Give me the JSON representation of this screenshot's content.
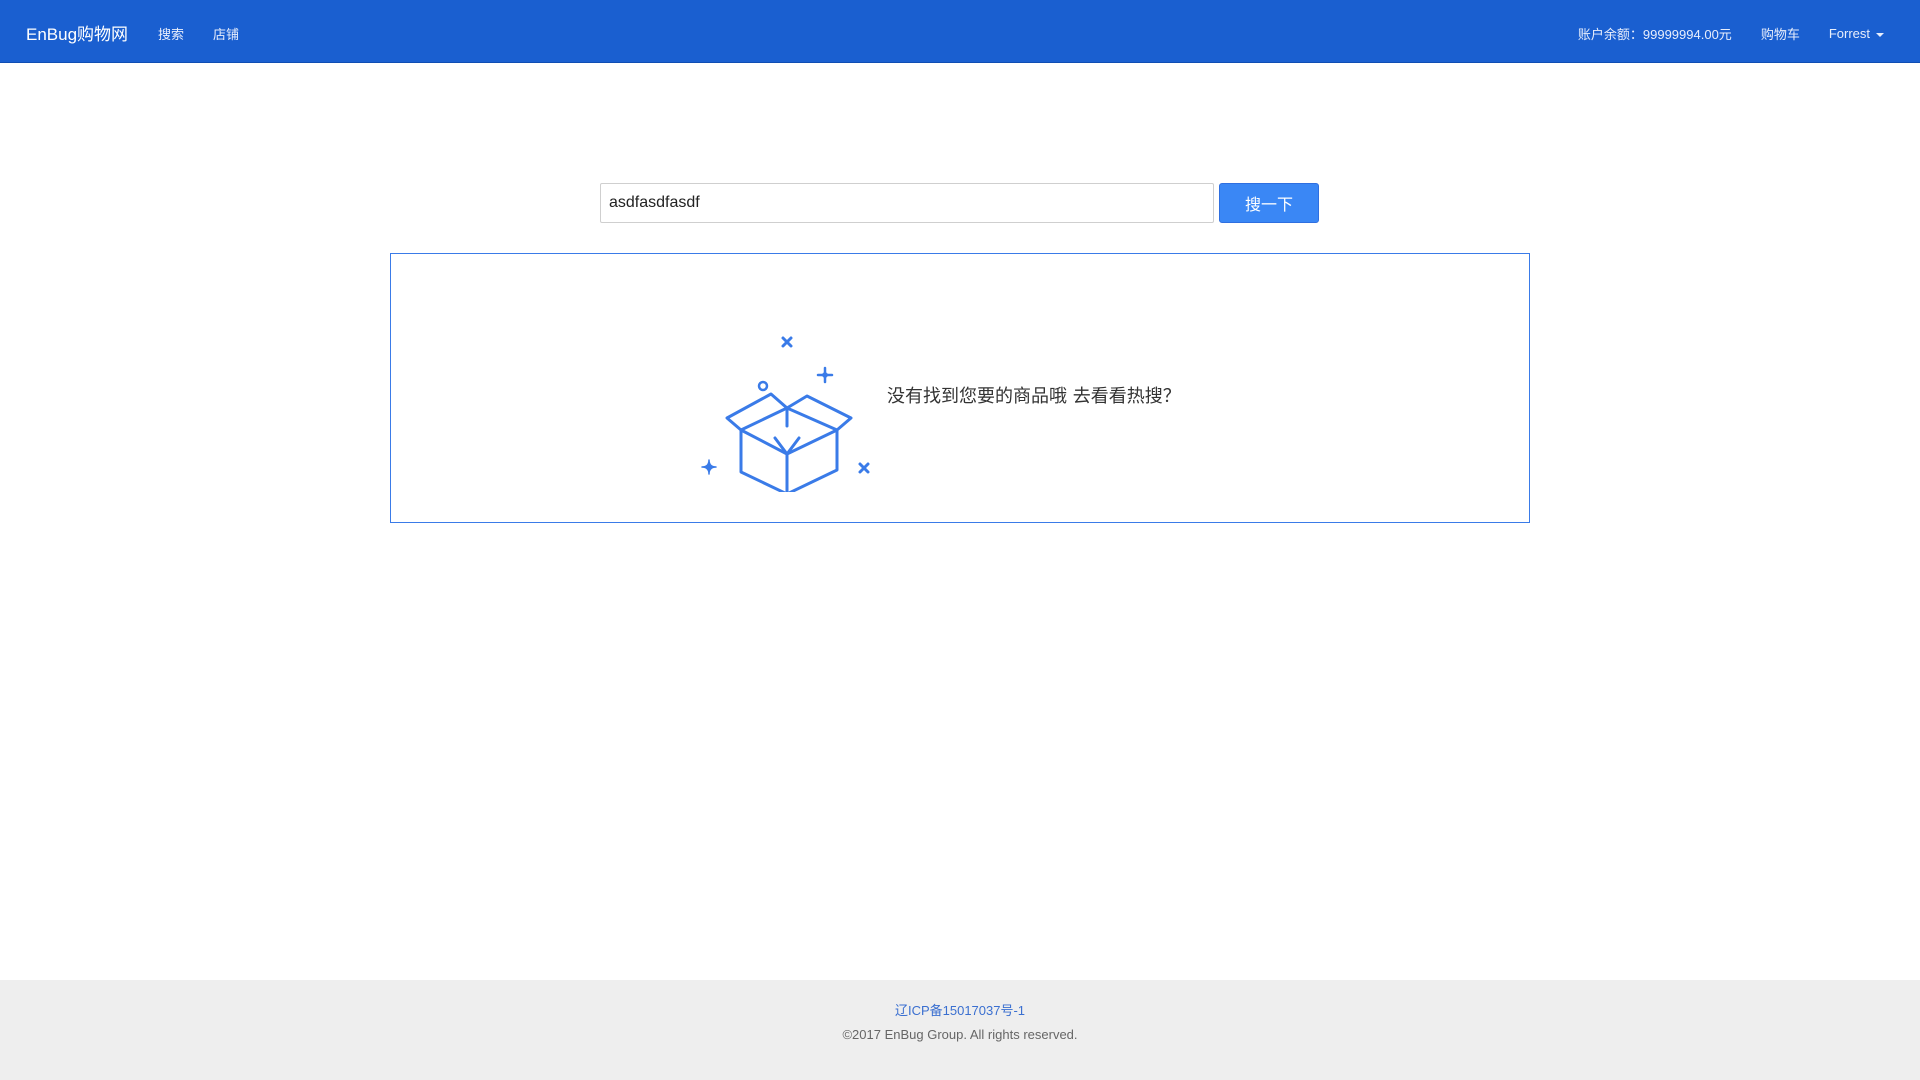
{
  "navbar": {
    "brand": "EnBug购物网",
    "left_links": [
      "搜索",
      "店铺"
    ],
    "balance": "账户余额：99999994.00元",
    "cart": "购物车",
    "user": "Forrest",
    "background_color": "#1a5fd0"
  },
  "search": {
    "value": "asdfasdfasdf",
    "button_label": "搜一下"
  },
  "empty_state": {
    "icon": "open-box-icon",
    "message": "没有找到您要的商品哦 去看看热搜？",
    "accent_color": "#3a7be8"
  },
  "footer": {
    "icp": "辽ICP备15017037号-1",
    "copyright": "©2017 EnBug Group. All rights reserved."
  }
}
